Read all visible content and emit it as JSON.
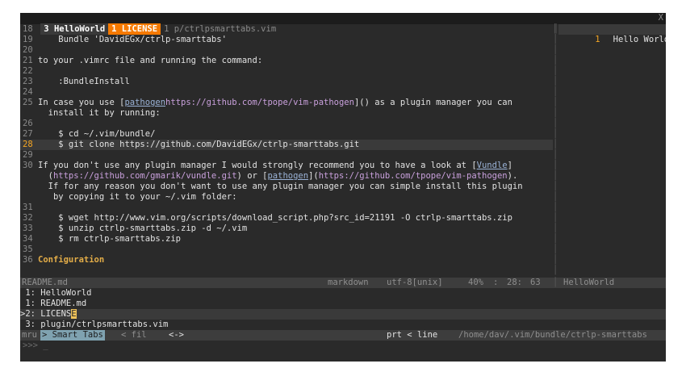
{
  "tabs": [
    {
      "label": "3 HelloWorld",
      "state": "current"
    },
    {
      "label": "1 LICENSE",
      "state": "active"
    },
    {
      "label": "1 p/ctrlpsmarttabs.vim",
      "state": "inactive"
    }
  ],
  "tab_close": "X",
  "editor": {
    "lines": [
      {
        "n": "18",
        "t": ""
      },
      {
        "n": "19",
        "t": "    Bundle 'DavidEGx/ctrlp-smarttabs'"
      },
      {
        "n": "20",
        "t": ""
      },
      {
        "n": "21",
        "t": "to your .vimrc file and running the command:"
      },
      {
        "n": "22",
        "t": ""
      },
      {
        "n": "23",
        "t": "    :BundleInstall"
      },
      {
        "n": "24",
        "t": ""
      },
      {
        "n": "25",
        "a": "In case you use [",
        "link": "pathogen",
        "b": "](",
        "url": "https://github.com/tpope/vim-pathogen",
        "c": ") as a plugin manager you can"
      },
      {
        "n": "",
        "t": "  install it by running:"
      },
      {
        "n": "26",
        "t": ""
      },
      {
        "n": "27",
        "t": "    $ cd ~/.vim/bundle/"
      },
      {
        "n": "28",
        "t": "    $ git clone https://github.com/DavidEGx/ctrlp-smarttabs.git",
        "cur": true
      },
      {
        "n": "29",
        "t": ""
      },
      {
        "n": "30",
        "a": "If you don't use any plugin manager I would strongly recommend you to have a look at [",
        "link": "Vundle",
        "c": "]"
      },
      {
        "n": "",
        "pre": "  (",
        "url": "https://github.com/gmarik/vundle.git",
        "mid": ") or [",
        "link2": "pathogen",
        "mid2": "](",
        "url2": "https://github.com/tpope/vim-pathogen",
        "c": ")."
      },
      {
        "n": "",
        "t": "  If for any reason you don't want to use any plugin manager you can simple install this plugin"
      },
      {
        "n": "",
        "t": "   by copying it to your ~/.vim folder:"
      },
      {
        "n": "31",
        "t": ""
      },
      {
        "n": "32",
        "t": "    $ wget http://www.vim.org/scripts/download_script.php?src_id=21191 -O ctrlp-smarttabs.zip"
      },
      {
        "n": "33",
        "t": "    $ unzip ctrlp-smarttabs.zip -d ~/.vim"
      },
      {
        "n": "34",
        "t": "    $ rm ctrlp-smarttabs.zip"
      },
      {
        "n": "35",
        "t": ""
      },
      {
        "n": "36",
        "h": "Configuration"
      }
    ]
  },
  "right_pane": {
    "line_number": "1",
    "text": "Hello World!"
  },
  "statusline": {
    "file": "README.md",
    "filetype": "markdown",
    "encoding": "utf-8[unix]",
    "percent": "40%",
    "separator": ":",
    "line": "28:",
    "col": "63",
    "right_file": "HelloWorld"
  },
  "mru_list": [
    {
      "text": "1: HelloWorld",
      "selected": false
    },
    {
      "text": "1: README.md",
      "selected": false
    },
    {
      "text": "2: LICENS",
      "cursor": "E",
      "selected": true
    },
    {
      "text": "3: plugin/ctrlpsmarttabs.vim",
      "selected": false
    }
  ],
  "ctrlp": {
    "left_mode": "mru",
    "selected_mode": "> Smart Tabs",
    "next_mode": "< fil",
    "arrows": "<->",
    "prt": "prt < line",
    "path": "/home/dav/.vim/bundle/ctrlp-smarttabs"
  },
  "prompt": ">>> _"
}
